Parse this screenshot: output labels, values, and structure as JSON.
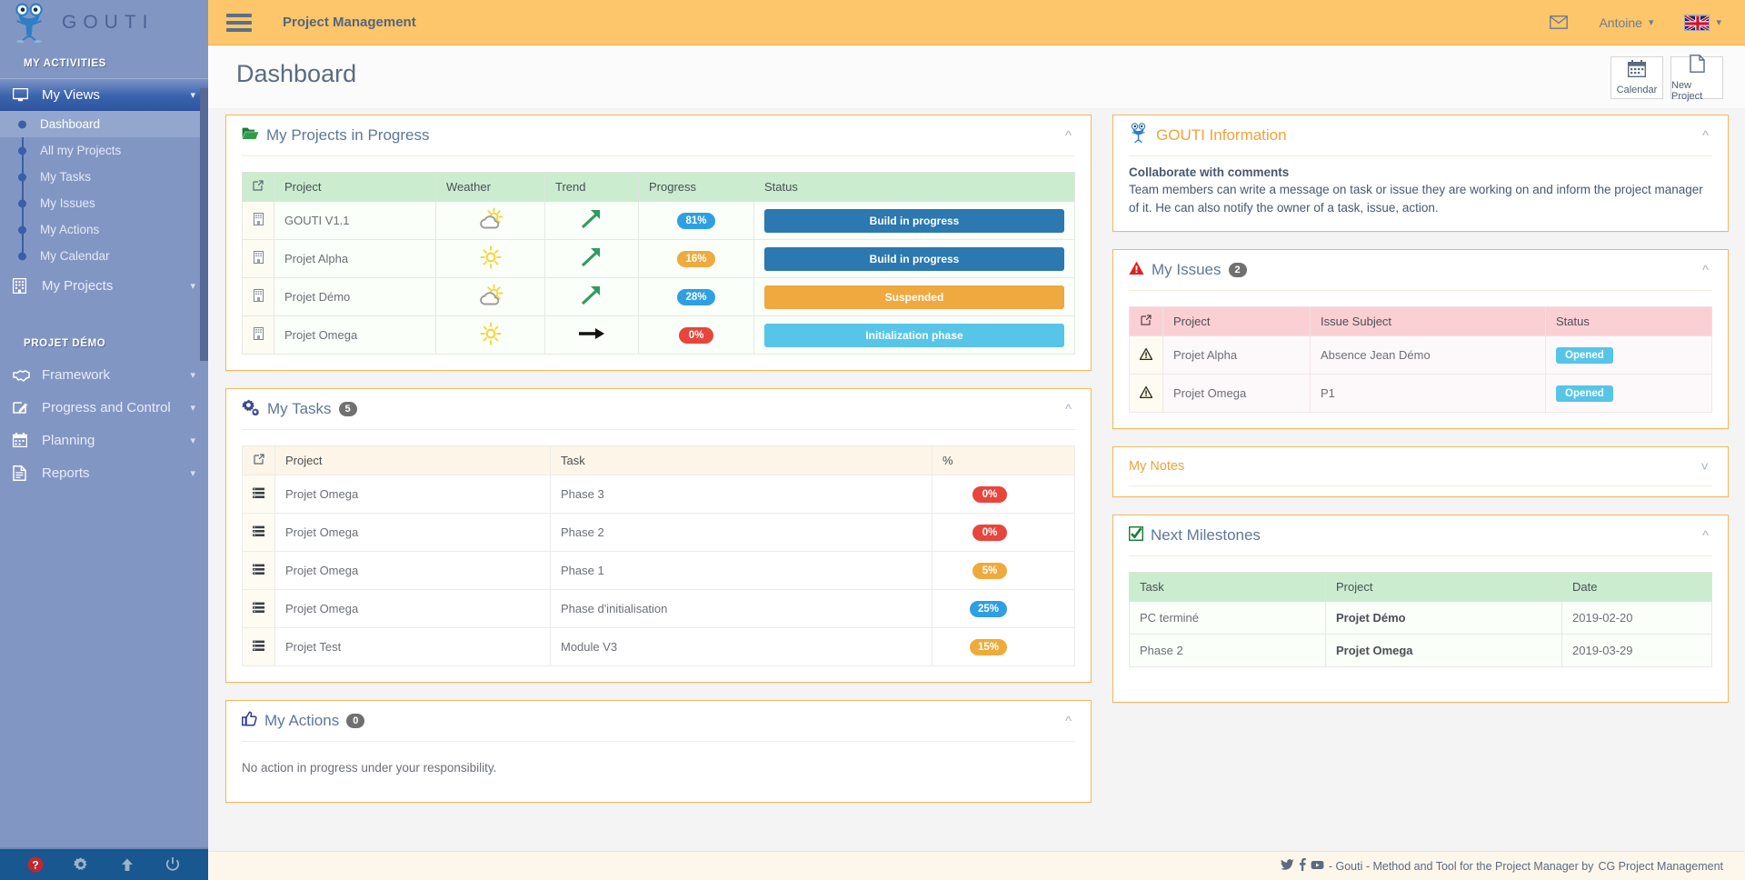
{
  "brand": {
    "name": "GOUTI",
    "logo_icon": "gouti-mascot-icon"
  },
  "sidebar": {
    "section1_title": "MY ACTIVITIES",
    "my_views": {
      "label": "My Views",
      "icon": "monitor-icon",
      "chevron": "chevron-down-icon"
    },
    "my_views_items": [
      {
        "label": "Dashboard"
      },
      {
        "label": "All my Projects"
      },
      {
        "label": "My Tasks"
      },
      {
        "label": "My Issues"
      },
      {
        "label": "My Actions"
      },
      {
        "label": "My Calendar"
      }
    ],
    "my_projects": {
      "label": "My Projects",
      "icon": "building-icon"
    },
    "section2_title": "PROJET DÉMO",
    "project_items": [
      {
        "label": "Framework",
        "icon": "handshake-icon"
      },
      {
        "label": "Progress and Control",
        "icon": "edit-square-icon"
      },
      {
        "label": "Planning",
        "icon": "calendar-icon"
      },
      {
        "label": "Reports",
        "icon": "document-icon"
      }
    ],
    "footer_icons": [
      {
        "name": "help-icon",
        "glyph": "?"
      },
      {
        "name": "gear-icon",
        "glyph": "⚙"
      },
      {
        "name": "upload-arrow-icon",
        "glyph": "↑"
      },
      {
        "name": "power-icon",
        "glyph": "⏻"
      }
    ]
  },
  "topbar": {
    "menu_icon": "hamburger-menu-icon",
    "app_title": "Project Management",
    "mail_icon": "envelope-icon",
    "user_name": "Antoine",
    "language": "en-GB",
    "chevron": "⌄"
  },
  "page": {
    "title": "Dashboard",
    "buttons": [
      {
        "label": "Calendar",
        "icon": "calendar-icon"
      },
      {
        "label": "New Project",
        "icon": "file-icon"
      }
    ]
  },
  "projects_panel": {
    "title": "My Projects in Progress",
    "icon": "open-folder-icon",
    "collapse_icon": "chevron-up-icon",
    "columns": [
      "",
      "Project",
      "Weather",
      "Trend",
      "Progress",
      "Status"
    ],
    "rows": [
      {
        "project": "GOUTI V1.1",
        "weather": "partly-cloudy",
        "trend": "up",
        "progress": "81%",
        "progress_color": "blue",
        "status": "Build in progress",
        "status_color": "blue"
      },
      {
        "project": "Projet Alpha",
        "weather": "sunny",
        "trend": "up",
        "progress": "16%",
        "progress_color": "orange",
        "status": "Build in progress",
        "status_color": "blue"
      },
      {
        "project": "Projet Démo",
        "weather": "partly-cloudy",
        "trend": "up",
        "progress": "28%",
        "progress_color": "blue",
        "status": "Suspended",
        "status_color": "orange"
      },
      {
        "project": "Projet Omega",
        "weather": "sunny",
        "trend": "flat",
        "progress": "0%",
        "progress_color": "red",
        "status": "Initialization phase",
        "status_color": "cyan"
      }
    ]
  },
  "tasks_panel": {
    "title": "My Tasks",
    "count": "5",
    "icon": "gears-icon",
    "collapse_icon": "chevron-up-icon",
    "columns": [
      "",
      "Project",
      "Task",
      "%"
    ],
    "rows": [
      {
        "project": "Projet Omega",
        "task": "Phase 3",
        "pct": "0%",
        "color": "red"
      },
      {
        "project": "Projet Omega",
        "task": "Phase 2",
        "pct": "0%",
        "color": "red"
      },
      {
        "project": "Projet Omega",
        "task": "Phase 1",
        "pct": "5%",
        "color": "orange"
      },
      {
        "project": "Projet Omega",
        "task": "Phase d'initialisation",
        "pct": "25%",
        "color": "blue"
      },
      {
        "project": "Projet Test",
        "task": "Module V3",
        "pct": "15%",
        "color": "orange"
      }
    ]
  },
  "actions_panel": {
    "title": "My Actions",
    "count": "0",
    "icon": "thumbs-up-icon",
    "collapse_icon": "chevron-up-icon",
    "empty_message": "No action in progress under your responsibility."
  },
  "info_panel": {
    "title": "GOUTI Information",
    "icon": "gouti-mascot-icon",
    "collapse_icon": "chevron-up-icon",
    "heading": "Collaborate with comments",
    "body": "Team members can write a message on task or issue they are working on and inform the project manager of it. He can also notify the owner of a task, issue, action."
  },
  "issues_panel": {
    "title": "My Issues",
    "count": "2",
    "icon": "warning-triangle-icon",
    "collapse_icon": "chevron-up-icon",
    "columns": [
      "",
      "Project",
      "Issue Subject",
      "Status"
    ],
    "rows": [
      {
        "project": "Projet Alpha",
        "subject": "Absence Jean Démo",
        "status": "Opened"
      },
      {
        "project": "Projet Omega",
        "subject": "P1",
        "status": "Opened"
      }
    ]
  },
  "notes_panel": {
    "title": "My Notes",
    "collapse_icon": "chevron-down-icon"
  },
  "milestones_panel": {
    "title": "Next Milestones",
    "icon": "checked-box-icon",
    "collapse_icon": "chevron-up-icon",
    "columns": [
      "Task",
      "Project",
      "Date"
    ],
    "rows": [
      {
        "task": "PC terminé",
        "project": "Projet Démo",
        "date": "2019-02-20"
      },
      {
        "task": "Phase 2",
        "project": "Projet Omega",
        "date": "2019-03-29"
      }
    ]
  },
  "footer": {
    "twitter_icon": "twitter-icon",
    "facebook_icon": "facebook-icon",
    "youtube_icon": "youtube-icon",
    "text": "- Gouti - Method and Tool for the Project Manager by",
    "link": "CG Project Management"
  },
  "colors": {
    "topbar": "#fdc66a",
    "sidebar": "#8296c4",
    "accent_blue": "#2e9fe3",
    "accent_orange": "#eeab3c",
    "accent_red": "#e8453c",
    "status_blue": "#2c78b0",
    "status_cyan": "#56c5e8"
  }
}
